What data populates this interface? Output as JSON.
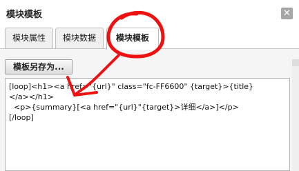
{
  "dialog": {
    "title": "模块模板",
    "close_glyph": "✕"
  },
  "tabs": [
    {
      "label": "模块属性",
      "active": false
    },
    {
      "label": "模块数据",
      "active": false
    },
    {
      "label": "模块模板",
      "active": true
    }
  ],
  "toolbar": {
    "save_as_label": "模板另存为..."
  },
  "editor": {
    "value": "[loop]<h1><a href=\"{url}\" class=\"fc-FF6600\" {target}>{title}\n</a></h1>\n  <p>{summary}[<a href=\"{url}\"{target}>详细</a>]</p>\n[/loop]"
  },
  "annotation": {
    "color": "#ee1111"
  }
}
